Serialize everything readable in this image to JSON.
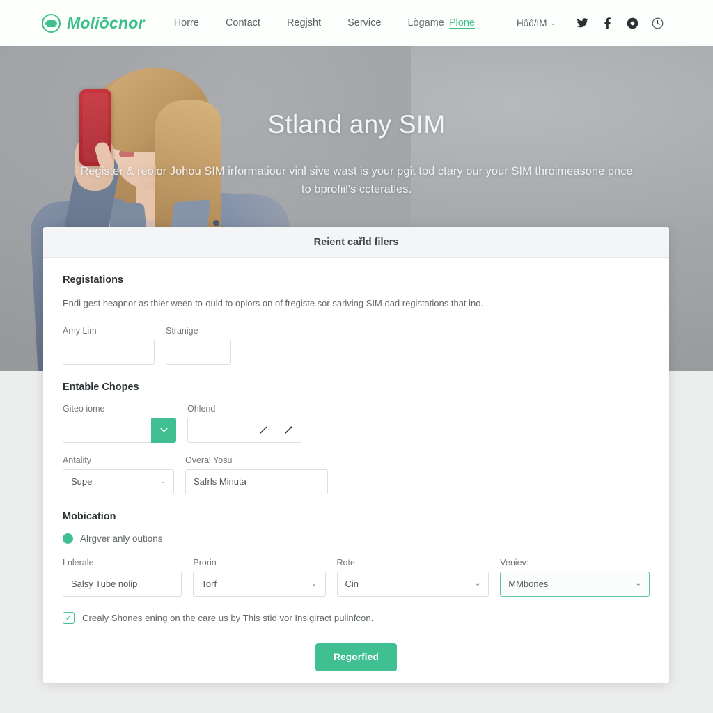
{
  "navbar": {
    "brand": "Moliōcnor",
    "brand_icon": "globe-leaf-logo-icon",
    "links": [
      {
        "label": "Horre",
        "name": "home"
      },
      {
        "label": "Contact",
        "name": "contact"
      },
      {
        "label": "Regjsht",
        "name": "regjsht"
      },
      {
        "label": "Service",
        "name": "service"
      }
    ],
    "login_label": "Lògame",
    "login_link": "Plone",
    "lang_select": "Hôô/IM",
    "lang_caret": "⌄",
    "socials": [
      {
        "name": "twitter-icon"
      },
      {
        "name": "facebook-icon"
      },
      {
        "name": "record-circle-icon"
      },
      {
        "name": "clock-icon"
      }
    ]
  },
  "hero": {
    "title": "Stland any SIM",
    "subtitle_line1": "Register & reolor Johou SIM irformatiour vinl sive wast is your pgit tod ctary our your SIM",
    "subtitle_line2": "throimeasone pnce to bprofiil's ccteratles."
  },
  "card": {
    "header_title": "Reient cařld filers",
    "section1": {
      "title": "Registations",
      "description": "Endi gest heapnor as thier ween to-ould to opiors on of fregiste sor sariving SIM oad registations that ino.",
      "fields": [
        {
          "label": "Amy Lim",
          "value": "",
          "placeholder": ""
        },
        {
          "label": "Stranige",
          "value": "",
          "placeholder": ""
        }
      ]
    },
    "section2": {
      "title": "Entable Chopes",
      "field_dropdown": {
        "label": "Giteo iome",
        "value": "",
        "button_icon": "chevron-down-icon"
      },
      "field_icons": {
        "label": "Ohlend",
        "value": "",
        "icon1": "pencil-edit-icon",
        "icon2": "pen-tool-icon"
      },
      "field_select": {
        "label": "Antality",
        "value": "Supe",
        "caret": "⌄"
      },
      "field_text": {
        "label": "Overal Yosu",
        "value": "Safrls Minuta"
      }
    },
    "section3": {
      "title": "Mobication",
      "radio_label": "Alrgver anly outions",
      "fields": [
        {
          "label": "Lnlerale",
          "type": "text",
          "value": "Salsy Tube nolip"
        },
        {
          "label": "Prorin",
          "type": "select",
          "value": "Torf",
          "caret": "⌄"
        },
        {
          "label": "Rote",
          "type": "select",
          "value": "Cin",
          "caret": "⌄"
        },
        {
          "label": "Veniev:",
          "type": "select",
          "value": "MMbones",
          "caret": "⌄",
          "focused": true
        }
      ],
      "checkbox": {
        "checked": true,
        "mark": "✓",
        "label": "Crealy Shones ening on the care us by This stid vor Insigiract pulinfcon."
      }
    },
    "submit_label": "Regorfied"
  },
  "colors": {
    "brand_green": "#3fbf92",
    "page_bg": "#eceded",
    "hero_grey": "#a3a5a8",
    "card_header_bg": "#f4f5f6"
  }
}
